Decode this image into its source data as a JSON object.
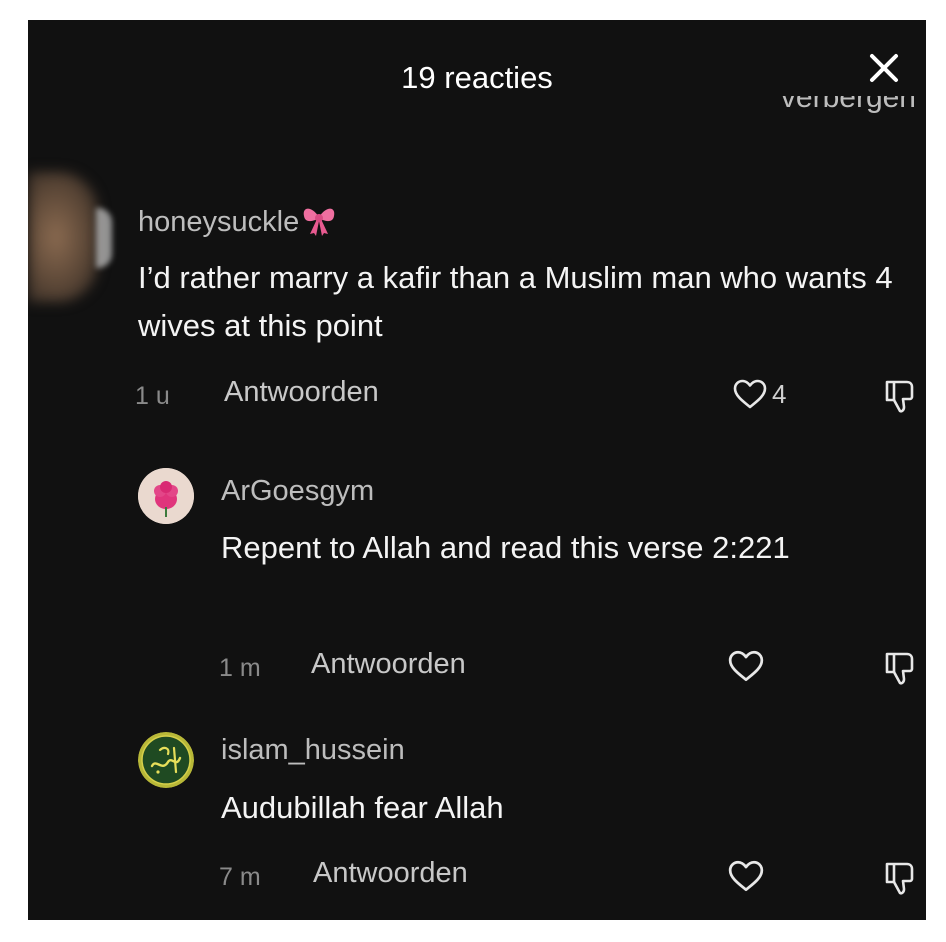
{
  "header": {
    "title": "19 reacties",
    "hide_label": "verbergen"
  },
  "comments": [
    {
      "username": "honeysuckle",
      "text": "I’d rather marry a kafir than a Muslim man who wants 4 wives at this point",
      "time": "1 u",
      "reply_label": "Antwoorden",
      "likes": "4"
    },
    {
      "username": "ArGoesgym",
      "text": "Repent to Allah and read this verse 2:221",
      "time": "1 m",
      "reply_label": "Antwoorden",
      "likes": ""
    },
    {
      "username": "islam_hussein",
      "text": "Audubillah fear Allah",
      "time": "7 m",
      "reply_label": "Antwoorden",
      "likes": ""
    }
  ],
  "colors": {
    "background": "#111111",
    "text": "#f4f4f4",
    "muted": "#8a8a8a",
    "bow": "#f06fa0"
  },
  "icons": {
    "close": "close-icon",
    "like": "heart-outline-icon",
    "dislike": "thumbs-down-outline-icon",
    "username_emoji": "ribbon-bow-emoji-icon"
  }
}
